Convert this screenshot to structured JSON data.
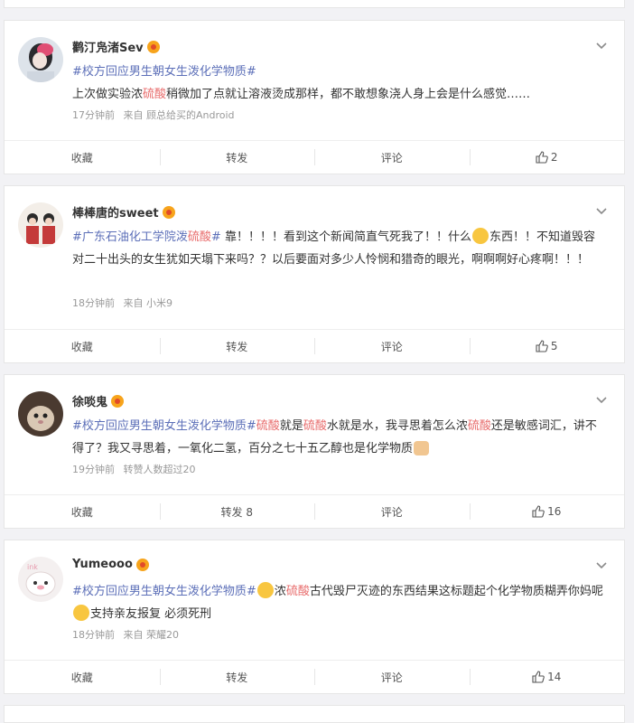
{
  "posts": [
    {
      "username": "鹳汀凫渚Sev",
      "content": [
        {
          "t": "#校方回应男生朝女生泼化学物质#",
          "c": "tag"
        },
        {
          "t": "\n上次做实验浓",
          "c": ""
        },
        {
          "t": "硫酸",
          "c": "red"
        },
        {
          "t": "稍微加了点就让溶液烫成那样，都不敢想象浇人身上会是什么感觉……",
          "c": ""
        }
      ],
      "time": "17分钟前",
      "source": "来自 顾总给买的Android",
      "actions": {
        "fav": "收藏",
        "repost": "转发",
        "comment": "评论",
        "likes": "2"
      }
    },
    {
      "username": "棒棒唐的sweet",
      "content": [
        {
          "t": "#广东石油化工学院泼",
          "c": "tag"
        },
        {
          "t": "硫酸",
          "c": "red"
        },
        {
          "t": "#",
          "c": "tag"
        },
        {
          "t": " 靠！！！！看到这个新闻简直气死我了！！什么",
          "c": ""
        },
        {
          "t": "E",
          "c": "emoji"
        },
        {
          "t": "东西！！不知道毁容对二十出头的女生犹如天塌下来吗？？以后要面对多少人怜悯和猎奇的眼光，啊啊啊好心疼啊！！！",
          "c": ""
        }
      ],
      "time": "18分钟前",
      "source": "来自 小米9",
      "actions": {
        "fav": "收藏",
        "repost": "转发",
        "comment": "评论",
        "likes": "5"
      }
    },
    {
      "username": "徐啖鬼",
      "content": [
        {
          "t": "#校方回应男生朝女生泼化学物质#",
          "c": "tag"
        },
        {
          "t": "硫酸",
          "c": "red"
        },
        {
          "t": "就是",
          "c": ""
        },
        {
          "t": "硫酸",
          "c": "red"
        },
        {
          "t": "水就是水，我寻思着怎么浓",
          "c": ""
        },
        {
          "t": "硫酸",
          "c": "red"
        },
        {
          "t": "还是敏感词汇，讲不得了？我又寻思着，一氧化二氢，百分之七十五乙醇也是化学物质",
          "c": ""
        },
        {
          "t": "H",
          "c": "hand"
        }
      ],
      "time": "19分钟前",
      "source": "转赞人数超过20",
      "actions": {
        "fav": "收藏",
        "repost": "转发 8",
        "comment": "评论",
        "likes": "16"
      }
    },
    {
      "username": "Yumeooo",
      "content": [
        {
          "t": "#校方回应男生朝女生泼化学物质#",
          "c": "tag"
        },
        {
          "t": "E",
          "c": "emoji"
        },
        {
          "t": "浓",
          "c": ""
        },
        {
          "t": "硫酸",
          "c": "red"
        },
        {
          "t": "古代毁尸灭迹的东西结果这标题起个化学物质糊弄你妈呢",
          "c": ""
        },
        {
          "t": "E",
          "c": "emoji"
        },
        {
          "t": "支持亲友报复 必须死刑",
          "c": ""
        }
      ],
      "time": "18分钟前",
      "source": "来自 荣耀20",
      "actions": {
        "fav": "收藏",
        "repost": "转发",
        "comment": "评论",
        "likes": "14"
      }
    }
  ],
  "colors": {
    "accent": "#5c6fb8",
    "keyword": "#e86c6c",
    "crown": "#f7a41c"
  },
  "icons": {
    "crown": "vip-crown-icon",
    "chevron": "chevron-down-icon",
    "like": "thumbs-up-icon"
  }
}
